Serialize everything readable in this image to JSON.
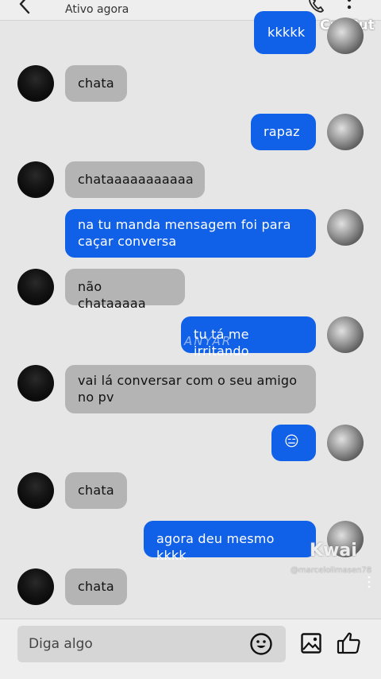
{
  "header": {
    "status": "Ativo agora"
  },
  "watermarks": {
    "capcut": "CapCut",
    "kwai": "Kwai",
    "handle": "@marcelolimasen78",
    "center": "ANYAR"
  },
  "messages": [
    {
      "from": "me",
      "text": "kkkkk"
    },
    {
      "from": "them",
      "text": "chata"
    },
    {
      "from": "me",
      "text": "rapaz"
    },
    {
      "from": "them",
      "text": "chataaaaaaaaaaa"
    },
    {
      "from": "me",
      "text": "na tu manda mensagem foi para caçar conversa"
    },
    {
      "from": "them",
      "text": "não chataaaaa"
    },
    {
      "from": "me",
      "text": "tu tá me irritando"
    },
    {
      "from": "them",
      "text": "vai lá conversar com o seu amigo no pv"
    },
    {
      "from": "me",
      "text": "😑"
    },
    {
      "from": "them",
      "text": "chata"
    },
    {
      "from": "me",
      "text": "agora deu mesmo kkkk"
    },
    {
      "from": "them",
      "text": "chata"
    }
  ],
  "composer": {
    "placeholder": "Diga algo"
  },
  "icons": {
    "back": "back-arrow-icon",
    "call": "phone-icon",
    "more": "more-vertical-icon",
    "emoji": "emoji-icon",
    "image": "image-icon",
    "like": "thumbs-up-icon"
  },
  "colors": {
    "sent_bubble": "#1160e8",
    "received_bubble": "#b4b4b4",
    "background": "#e6e6e6"
  }
}
